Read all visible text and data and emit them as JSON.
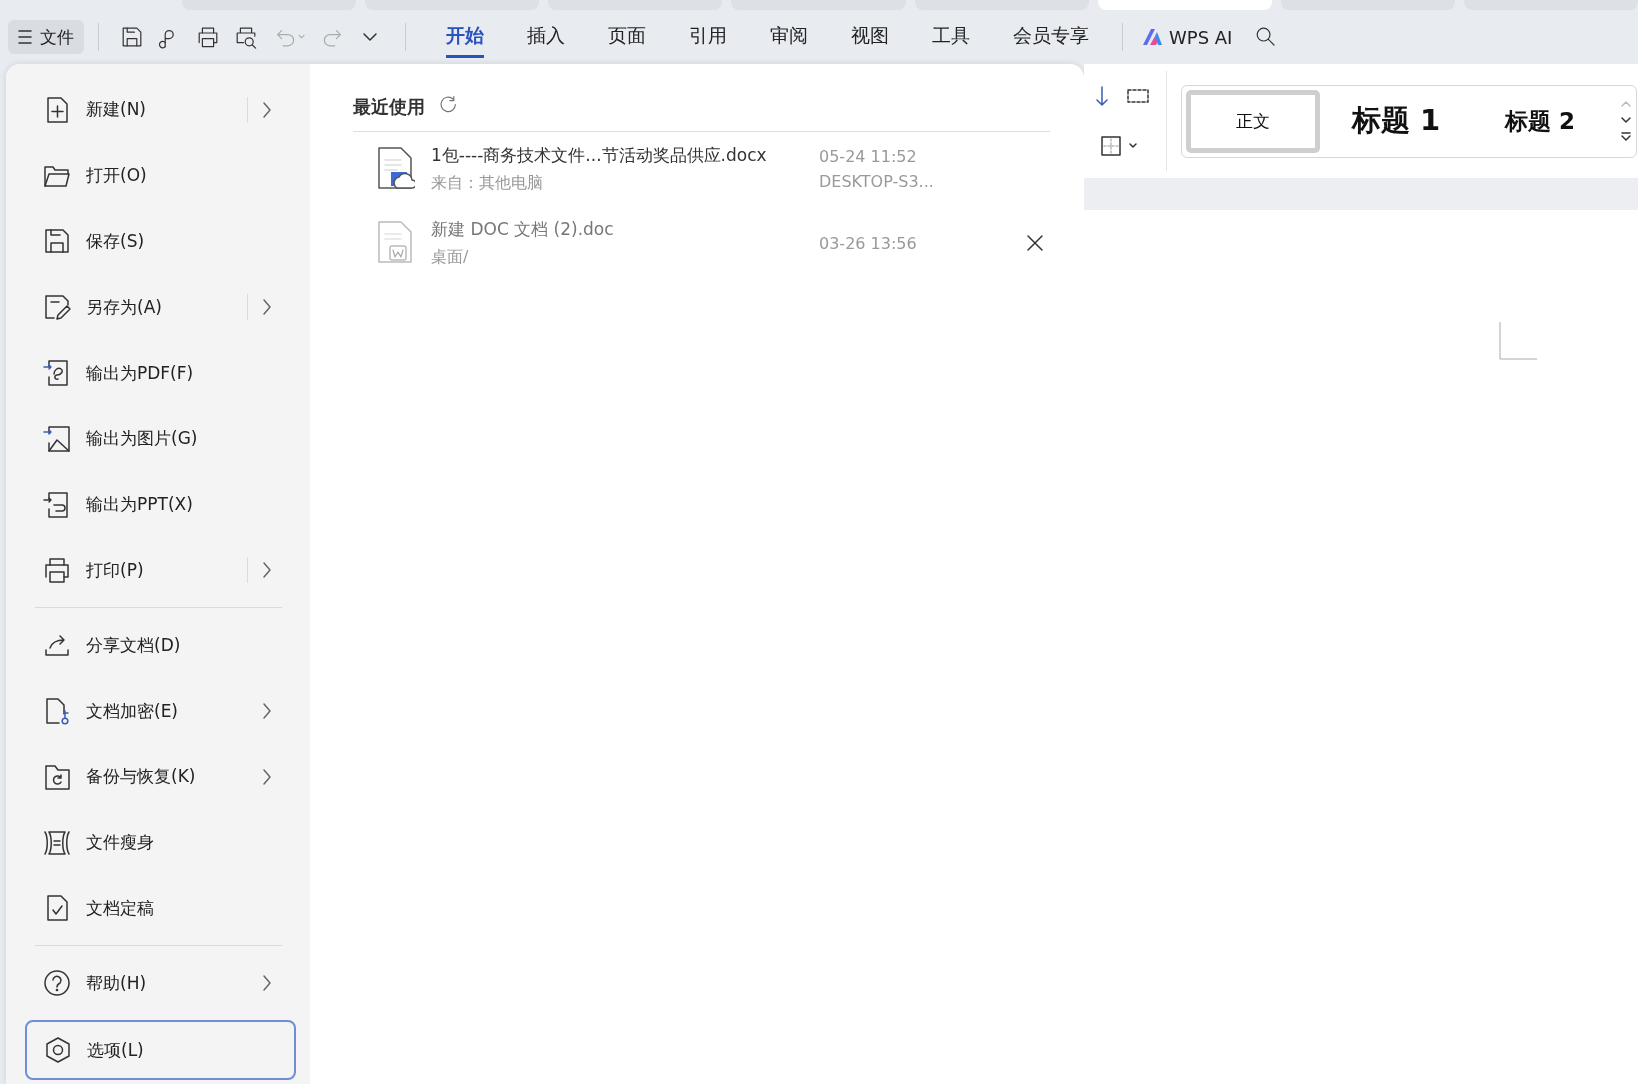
{
  "document_tabs": [
    {
      "selected": false
    },
    {
      "selected": false
    },
    {
      "selected": false
    },
    {
      "selected": false
    },
    {
      "selected": false
    },
    {
      "selected": true
    },
    {
      "selected": false
    },
    {
      "selected": false
    }
  ],
  "toolbar": {
    "file_button": "文件",
    "tabs": [
      {
        "label": "开始",
        "selected": true
      },
      {
        "label": "插入",
        "selected": false
      },
      {
        "label": "页面",
        "selected": false
      },
      {
        "label": "引用",
        "selected": false
      },
      {
        "label": "审阅",
        "selected": false
      },
      {
        "label": "视图",
        "selected": false
      },
      {
        "label": "工具",
        "selected": false
      },
      {
        "label": "会员专享",
        "selected": false
      }
    ],
    "ai_button": "WPS AI"
  },
  "file_menu": {
    "sections": [
      [
        {
          "label": "新建(N)",
          "submenu": true,
          "selected": false
        },
        {
          "label": "打开(O)",
          "submenu": false,
          "selected": false
        },
        {
          "label": "保存(S)",
          "submenu": false,
          "selected": false
        },
        {
          "label": "另存为(A)",
          "submenu": true,
          "selected": false
        },
        {
          "label": "输出为PDF(F)",
          "submenu": false,
          "selected": false
        },
        {
          "label": "输出为图片(G)",
          "submenu": false,
          "selected": false
        },
        {
          "label": "输出为PPT(X)",
          "submenu": false,
          "selected": false
        },
        {
          "label": "打印(P)",
          "submenu": true,
          "selected": false
        }
      ],
      [
        {
          "label": "分享文档(D)",
          "submenu": false,
          "selected": false
        },
        {
          "label": "文档加密(E)",
          "submenu": true,
          "selected": false
        },
        {
          "label": "备份与恢复(K)",
          "submenu": true,
          "selected": false
        },
        {
          "label": "文件瘦身",
          "submenu": false,
          "selected": false
        },
        {
          "label": "文档定稿",
          "submenu": false,
          "selected": false
        }
      ],
      [
        {
          "label": "帮助(H)",
          "submenu": true,
          "selected": false
        },
        {
          "label": "选项(L)",
          "submenu": false,
          "selected": true
        }
      ]
    ]
  },
  "recent": {
    "title": "最近使用",
    "files": [
      {
        "name": "1包----商务技术文件...节活动奖品供应.docx",
        "location": "来自：其他电脑",
        "date": "05-24 11:52",
        "device": "DESKTOP-S3...",
        "kind": "cloud",
        "hovered": false
      },
      {
        "name": "新建 DOC 文档 (2).doc",
        "location": "桌面/",
        "date": "03-26 13:56",
        "kind": "local",
        "hovered": true
      }
    ]
  },
  "styles": [
    {
      "label": "正文",
      "kind": "body",
      "selected": true
    },
    {
      "label": "标题 1",
      "kind": "heading1",
      "selected": false
    },
    {
      "label": "标题 2",
      "kind": "heading2",
      "selected": false
    }
  ]
}
